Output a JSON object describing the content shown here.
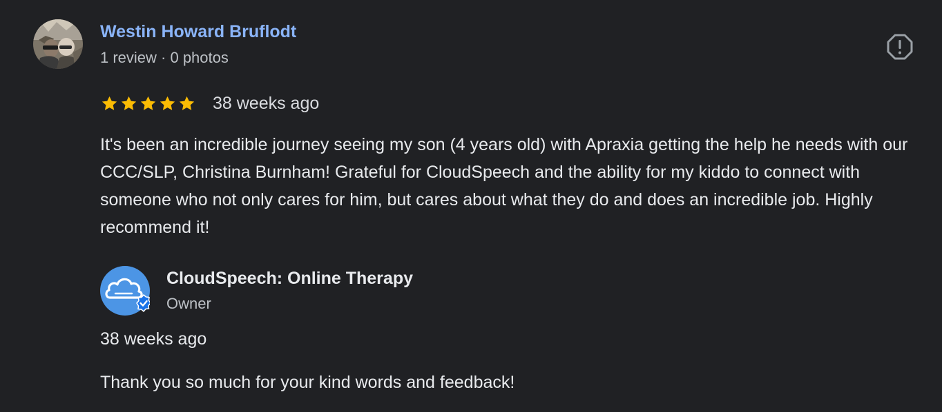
{
  "reviewer": {
    "name": "Westin Howard Bruflodt",
    "meta": "1 review · 0 photos",
    "avatar_icon": "reviewer-photo"
  },
  "review": {
    "rating": 5,
    "rating_max": 5,
    "star_color": "#fbbc04",
    "date": "38 weeks ago",
    "text": "It's been an incredible journey seeing my son (4 years old) with Apraxia getting the help he needs with our CCC/SLP, Christina Burnham! Grateful for CloudSpeech and the ability for my kiddo to connect with someone who not only cares for him, but cares about what they do and does an incredible job. Highly recommend it!"
  },
  "actions": {
    "flag_icon": "report-icon"
  },
  "owner_response": {
    "business_name": "CloudSpeech: Online Therapy",
    "role": "Owner",
    "logo_icon": "cloud-logo",
    "verified_icon": "verified-badge-icon",
    "brand_color": "#4c95e5",
    "date": "38 weeks ago",
    "text": "Thank you so much for your kind words and feedback!"
  },
  "colors": {
    "background": "#202124",
    "link": "#8ab4f8",
    "secondary_text": "#bdc1c6"
  }
}
